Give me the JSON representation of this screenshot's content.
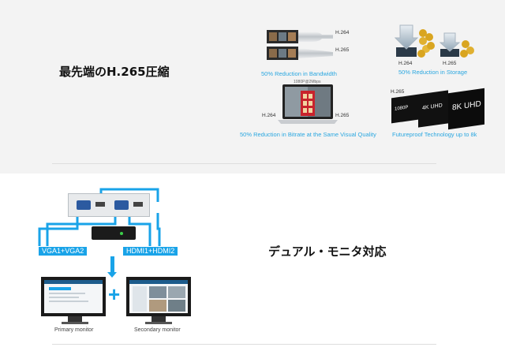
{
  "section1": {
    "title": "最先端のH.265圧縮",
    "features": {
      "bandwidth": {
        "caption": "50% Reduction in Bandwidth",
        "label_h264": "H.264",
        "label_h265": "H.265"
      },
      "storage": {
        "caption": "50% Reduction in Storage",
        "label_h264": "H.264",
        "label_h265": "H.265"
      },
      "bitrate": {
        "caption": "50% Reduction in Bitrate at the Same Visual Quality",
        "label_h264": "H.264",
        "label_h265": "H.265",
        "resolution_note": "1080P@2Mbps"
      },
      "future": {
        "caption": "Futureproof Technology up to 8k",
        "label_h265": "H.265",
        "res_1080p": "1080P",
        "res_4k": "4K UHD",
        "res_8k": "8K UHD"
      }
    }
  },
  "section2": {
    "title": "デュアル・モニタ対応",
    "vga_label": "VGA1+VGA2",
    "hdmi_label": "HDMI1+HDMI2",
    "plus": "+",
    "primary_caption": "Primary monitor",
    "secondary_caption": "Secondary monitor"
  },
  "colors": {
    "accent": "#19a3e8",
    "caption": "#2aa7e0",
    "gold": "#d9a520"
  }
}
